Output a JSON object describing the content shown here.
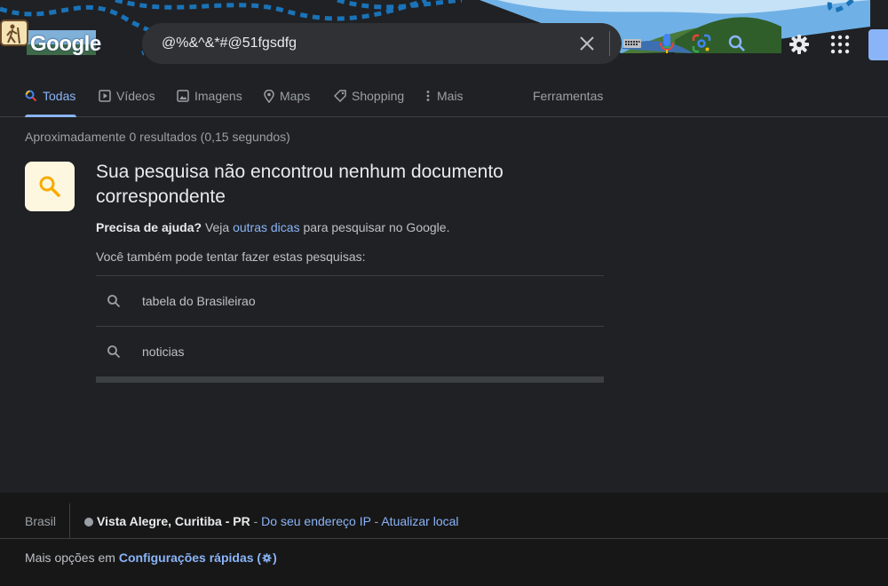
{
  "logo": {
    "text": "Google"
  },
  "search": {
    "query": "@%&^&*#@51fgsdfg"
  },
  "tabs": [
    {
      "label": "Todas"
    },
    {
      "label": "Vídeos"
    },
    {
      "label": "Imagens"
    },
    {
      "label": "Maps"
    },
    {
      "label": "Shopping"
    },
    {
      "label": "Mais"
    }
  ],
  "tools": {
    "label": "Ferramentas"
  },
  "results": {
    "stats": "Aproximadamente 0 resultados (0,15 segundos)",
    "no_results_title": "Sua pesquisa não encontrou nenhum documento correspondente",
    "help_bold": "Precisa de ajuda?",
    "help_pre": " Veja ",
    "help_link": "outras dicas",
    "help_post": " para pesquisar no Google.",
    "try_text": "Você também pode tentar fazer estas pesquisas:",
    "suggestions": [
      "tabela do Brasileirao",
      "noticias"
    ]
  },
  "footer": {
    "country": "Brasil",
    "location": "Vista Alegre, Curitiba - PR",
    "sep1": " - ",
    "ip_link": "Do seu endereço IP",
    "sep2": " - ",
    "update_link": "Atualizar local",
    "more_prefix": "Mais opções em ",
    "quick_settings": "Configurações rápidas (",
    "quick_settings_close": ")"
  },
  "colors": {
    "background": "#202124",
    "accent": "#8ab4f8",
    "search_box": "#303134",
    "footer": "#171717"
  },
  "icons": {
    "clear": "close-icon",
    "keyboard": "keyboard-icon",
    "mic": "microphone-icon",
    "lens": "google-lens-icon",
    "search": "search-icon",
    "settings": "gear-icon",
    "apps": "apps-grid-icon"
  }
}
